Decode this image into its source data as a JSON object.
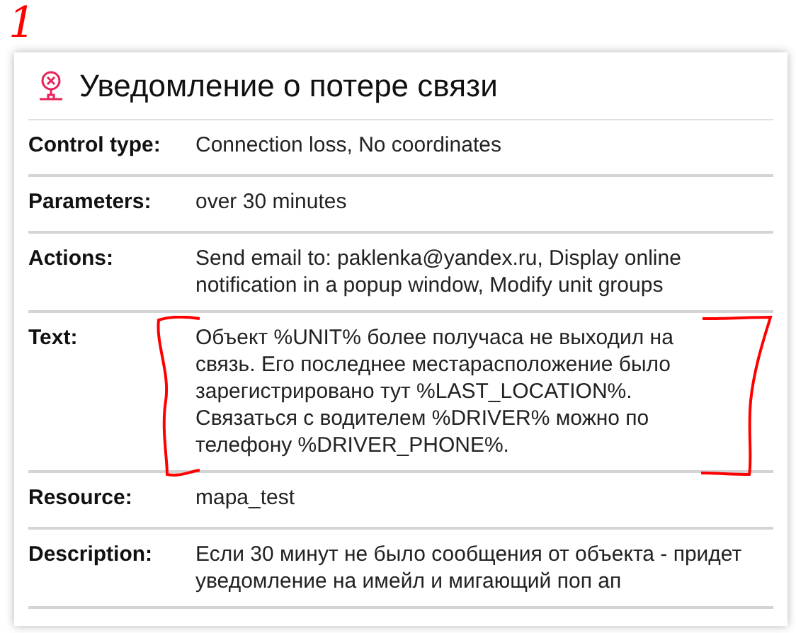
{
  "annotation": {
    "label": "1"
  },
  "popup": {
    "title": "Уведомление о потере связи",
    "rows": [
      {
        "label": "Control type:",
        "value": "Connection loss, No coordinates",
        "annotated": false
      },
      {
        "label": "Parameters:",
        "value": "over 30 minutes",
        "annotated": false
      },
      {
        "label": "Actions:",
        "value": "Send email to: paklenka@yandex.ru, Display online notification in a popup window, Modify unit groups",
        "annotated": false
      },
      {
        "label": "Text:",
        "value": "Объект %UNIT% более получаса не выходил на связь. Его последнее местарасположение было зарегистрировано тут %LAST_LOCATION%. Связаться с водителем %DRIVER% можно по телефону %DRIVER_PHONE%.",
        "annotated": true
      },
      {
        "label": "Resource:",
        "value": "mapa_test",
        "annotated": false
      },
      {
        "label": "Description:",
        "value": "Если 30 минут не было сообщения от объекта - придет уведомление на имейл и мигающий поп ап",
        "annotated": false
      }
    ]
  }
}
